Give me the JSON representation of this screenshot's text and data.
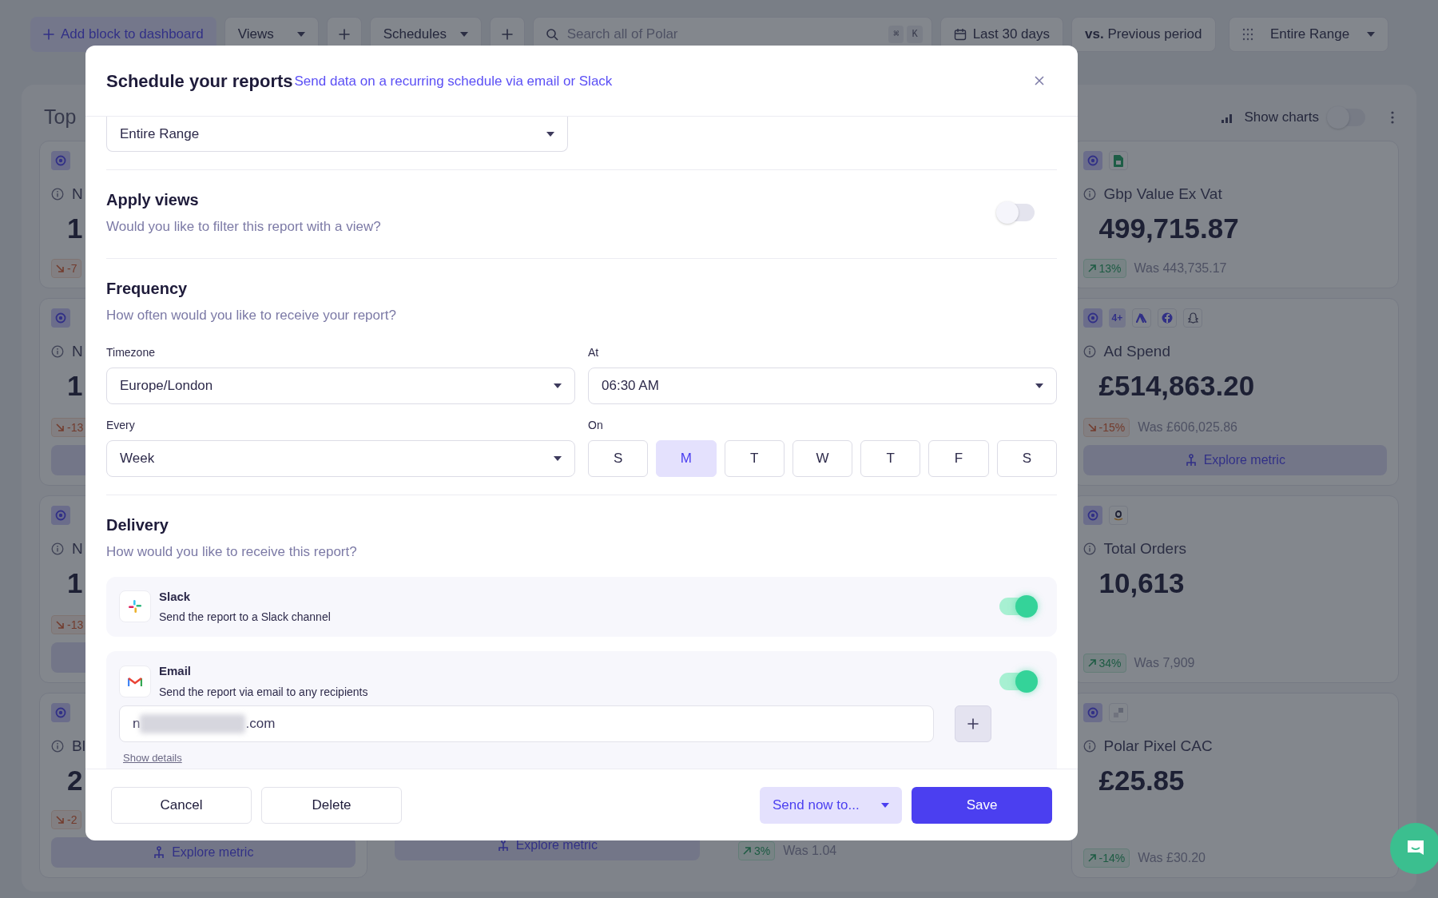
{
  "top_bar": {
    "add_block": "Add block to dashboard",
    "views": "Views",
    "schedules": "Schedules",
    "search": {
      "placeholder": "Search all of Polar",
      "keys": [
        "⌘",
        "K"
      ]
    },
    "date_range": "Last 30 days",
    "comparison": "**vs.** Previous period",
    "range": "Entire Range"
  },
  "section": {
    "title": "Top",
    "show_charts": {
      "label": "Show charts",
      "on": false
    }
  },
  "columns": [
    {
      "cards": [
        {
          "title": "N",
          "value": "1",
          "delta": "-7",
          "rising": false
        },
        {
          "title": "N",
          "value": "1",
          "delta": "-13",
          "rising": false,
          "explore": true
        },
        {
          "title": "N",
          "value": "1",
          "delta": "-13",
          "rising": false,
          "explore": true
        },
        {
          "title": "Bl",
          "value": "2",
          "delta": "-2",
          "rising": false,
          "explore": true,
          "explore_label": "Explore metric"
        }
      ]
    },
    {
      "cards": [
        {
          "explore": true,
          "explore_label": "Explore metric"
        }
      ]
    },
    {
      "cards": [
        {
          "delta": "3%",
          "rising": true,
          "was": "Was 1.04"
        }
      ]
    },
    {
      "cards": [
        {
          "sources": [
            {
              "kind": "sheet"
            }
          ],
          "title": "Gbp Value Ex Vat",
          "value": "499,715.87",
          "delta": "13%",
          "rising": true,
          "was": "Was 443,735.17"
        },
        {
          "sources": [
            {
              "kind": "count",
              "label": "4+"
            },
            {
              "kind": "ads"
            },
            {
              "kind": "facebook"
            },
            {
              "kind": "ghost"
            }
          ],
          "title": "Ad Spend",
          "value": "£514,863.20",
          "delta": "-15%",
          "rising": false,
          "was": "Was £606,025.86",
          "explore": true,
          "explore_label": "Explore metric"
        },
        {
          "sources": [
            {
              "kind": "amazon"
            }
          ],
          "title": "Total Orders",
          "value": "10,613",
          "delta": "34%",
          "rising": true,
          "was": "Was 7,909"
        },
        {
          "sources": [
            {
              "kind": "pixel"
            }
          ],
          "title": "Polar Pixel CAC",
          "value": "£25.85",
          "delta": "-14%",
          "rising": true,
          "was": "Was £30.20"
        }
      ]
    }
  ],
  "modal": {
    "title": "Schedule your reports",
    "subtitle": "Send data on a recurring schedule via email or Slack",
    "range_select": "Entire Range",
    "apply_views": {
      "title": "Apply views",
      "description": "Would you like to filter this report with a view?",
      "on": false
    },
    "frequency": {
      "title": "Frequency",
      "description": "How often would you like to receive your report?",
      "timezone": {
        "label": "Timezone",
        "value": "Europe/London"
      },
      "at": {
        "label": "At",
        "value": "06:30 AM"
      },
      "every": {
        "label": "Every",
        "value": "Week"
      },
      "days_label": "On",
      "days": [
        {
          "label": "S",
          "selected": false
        },
        {
          "label": "M",
          "selected": true
        },
        {
          "label": "T",
          "selected": false
        },
        {
          "label": "W",
          "selected": false
        },
        {
          "label": "T",
          "selected": false
        },
        {
          "label": "F",
          "selected": false
        },
        {
          "label": "S",
          "selected": false
        }
      ]
    },
    "delivery": {
      "title": "Delivery",
      "description": "How would you like to receive this report?",
      "channels": [
        {
          "kind": "slack",
          "name": "Slack",
          "description": "Send the report to a Slack channel",
          "on": true
        },
        {
          "kind": "email",
          "name": "Email",
          "description": "Send the report via email to any recipients",
          "on": true,
          "recipient_start": "n",
          "recipient_end": ".com",
          "details_link": "Show details"
        }
      ]
    },
    "footer": {
      "cancel": "Cancel",
      "delete": "Delete",
      "send_now": "Send now to...",
      "save": "Save"
    }
  }
}
